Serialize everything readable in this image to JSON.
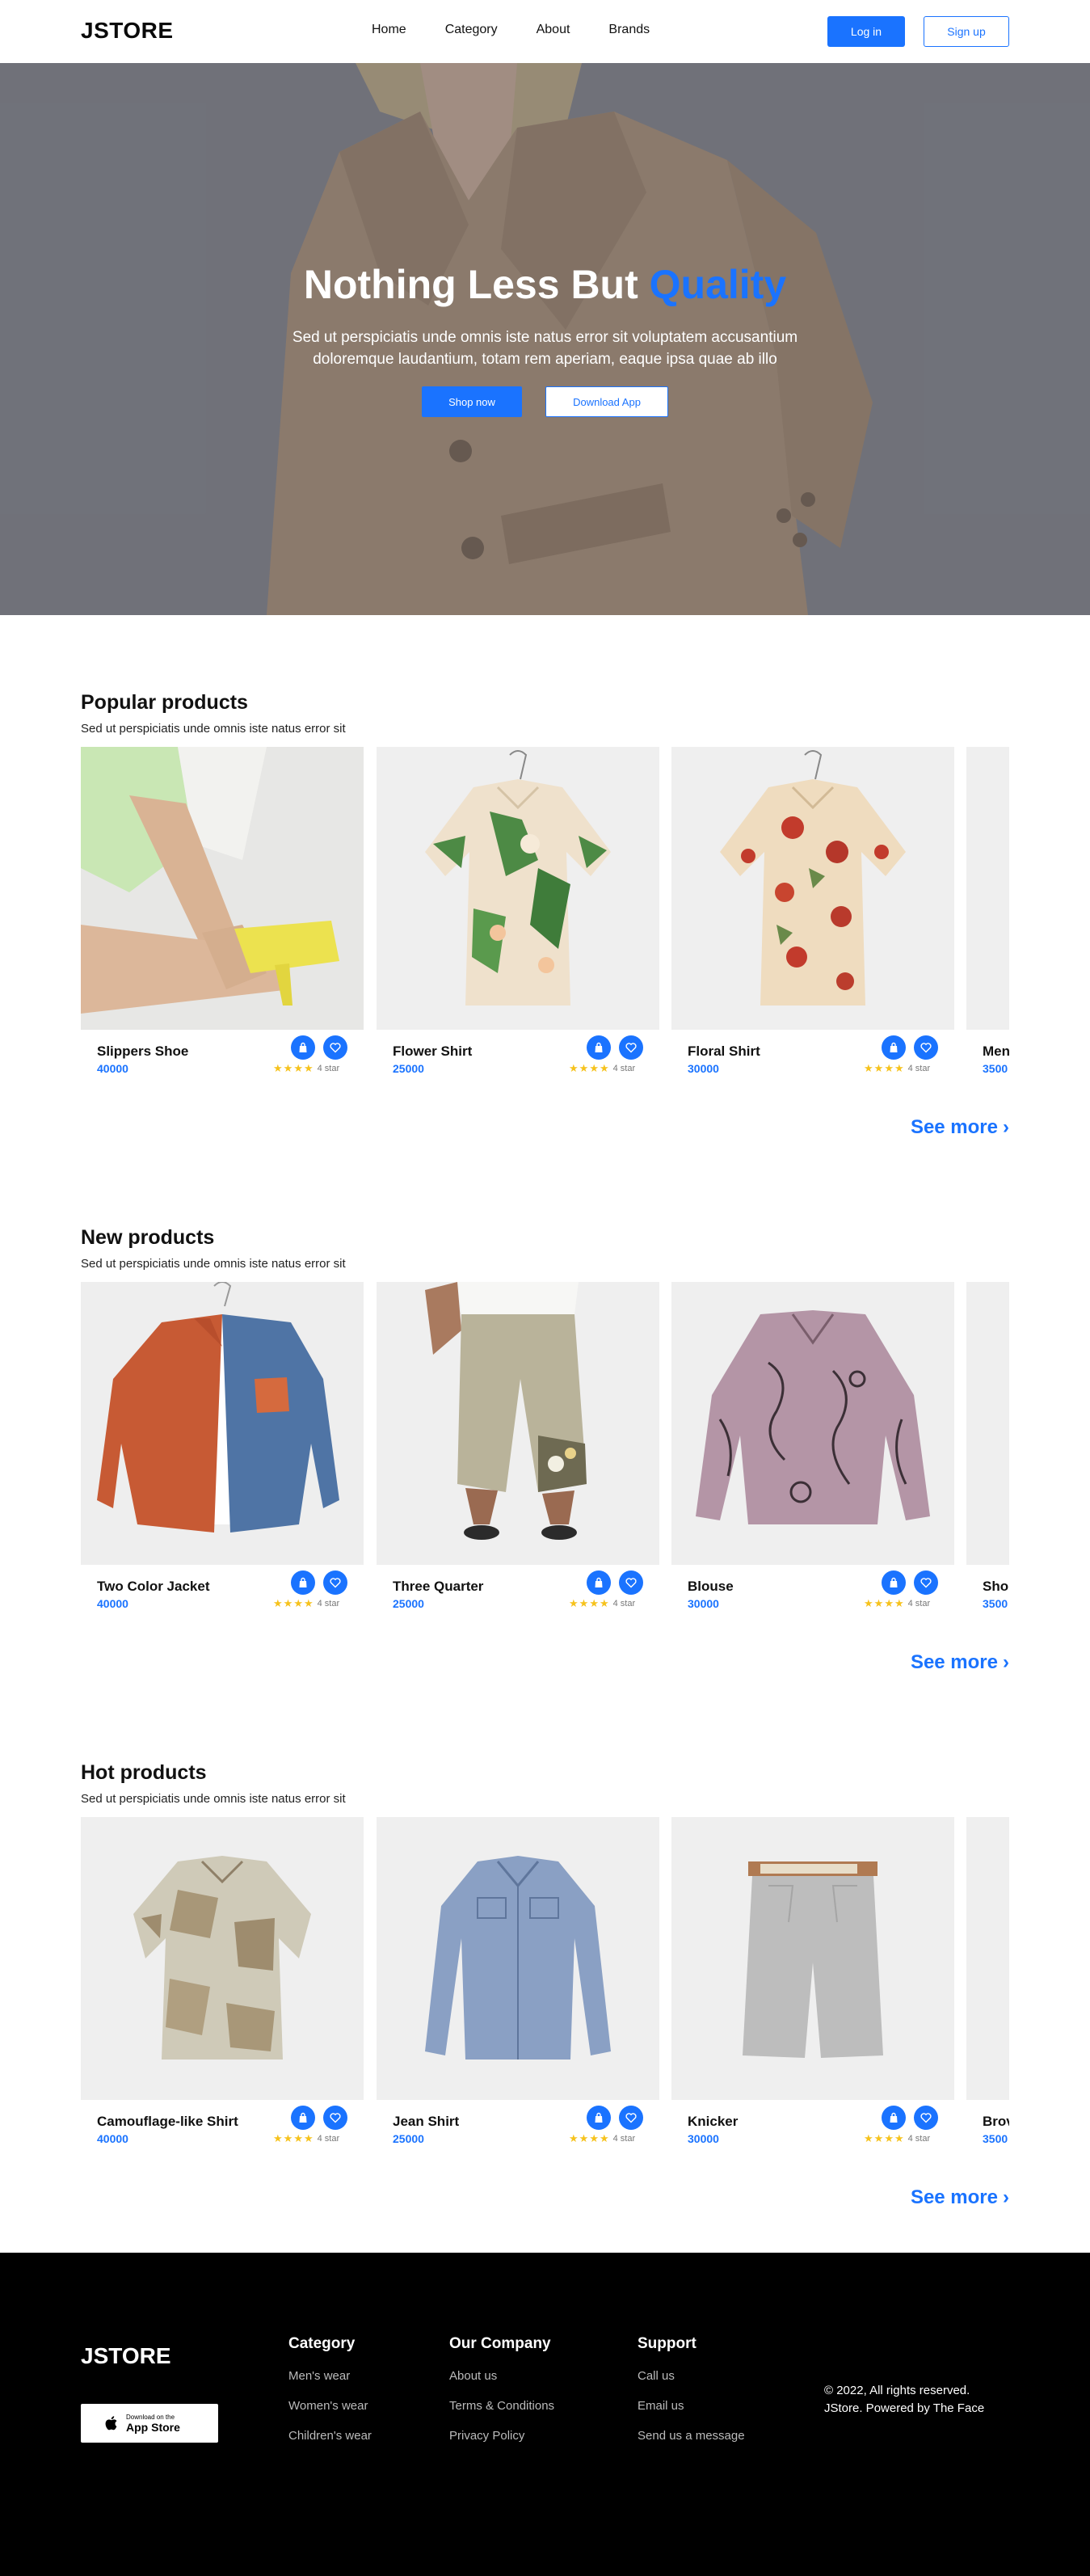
{
  "nav": {
    "logo": "JSTORE",
    "links": [
      "Home",
      "Category",
      "About",
      "Brands"
    ],
    "login": "Log in",
    "signup": "Sign up"
  },
  "hero": {
    "title_main": "Nothing Less But ",
    "title_accent": "Quality",
    "subtitle": "Sed ut perspiciatis unde omnis iste natus error sit voluptatem accusantium doloremque laudantium, totam rem aperiam, eaque ipsa quae ab illo",
    "shop_button": "Shop now",
    "download_button": "Download App"
  },
  "sections": [
    {
      "title": "Popular products",
      "subtitle": "Sed ut perspiciatis unde omnis iste natus error sit",
      "see_more": "See more",
      "products": [
        {
          "name": "Slippers Shoe",
          "price": "40000",
          "rating_label": "4 star",
          "image": "yellow-heels"
        },
        {
          "name": "Flower Shirt",
          "price": "25000",
          "rating_label": "4 star",
          "image": "tropical-shirt"
        },
        {
          "name": "Floral Shirt",
          "price": "30000",
          "rating_label": "4 star",
          "image": "rose-shirt"
        },
        {
          "name": "Men",
          "price": "3500",
          "rating_label": "",
          "image": "blank"
        }
      ]
    },
    {
      "title": "New products",
      "subtitle": "Sed ut perspiciatis unde omnis iste natus error sit",
      "see_more": "See more",
      "products": [
        {
          "name": "Two Color Jacket",
          "price": "40000",
          "rating_label": "4 star",
          "image": "two-color-jacket"
        },
        {
          "name": "Three Quarter",
          "price": "25000",
          "rating_label": "4 star",
          "image": "linen-pants"
        },
        {
          "name": "Blouse",
          "price": "30000",
          "rating_label": "4 star",
          "image": "printed-blouse"
        },
        {
          "name": "Sho",
          "price": "3500",
          "rating_label": "",
          "image": "blank"
        }
      ]
    },
    {
      "title": "Hot products",
      "subtitle": "Sed ut perspiciatis unde omnis iste natus error sit",
      "see_more": "See more",
      "products": [
        {
          "name": "Camouflage-like Shirt",
          "price": "40000",
          "rating_label": "4 star",
          "image": "camo-shirt"
        },
        {
          "name": "Jean Shirt",
          "price": "25000",
          "rating_label": "4 star",
          "image": "denim-shirt"
        },
        {
          "name": "Knicker",
          "price": "30000",
          "rating_label": "4 star",
          "image": "grey-shorts"
        },
        {
          "name": "Brov",
          "price": "3500",
          "rating_label": "",
          "image": "blank"
        }
      ]
    }
  ],
  "footer": {
    "logo": "JSTORE",
    "app_badge_small": "Download on the",
    "app_badge_big": "App Store",
    "columns": [
      {
        "title": "Category",
        "links": [
          "Men's wear",
          "Women's wear",
          "Children's wear"
        ]
      },
      {
        "title": "Our Company",
        "links": [
          "About us",
          "Terms & Conditions",
          "Privacy Policy"
        ]
      },
      {
        "title": "Support",
        "links": [
          "Call us",
          "Email us",
          "Send us a message"
        ]
      }
    ],
    "copyright_line1": "© 2022, All rights reserved.",
    "copyright_line2": "JStore. Powered by The Face"
  },
  "colors": {
    "accent": "#1a73ff",
    "star": "#f6c21c",
    "footer_bg": "#000000"
  }
}
